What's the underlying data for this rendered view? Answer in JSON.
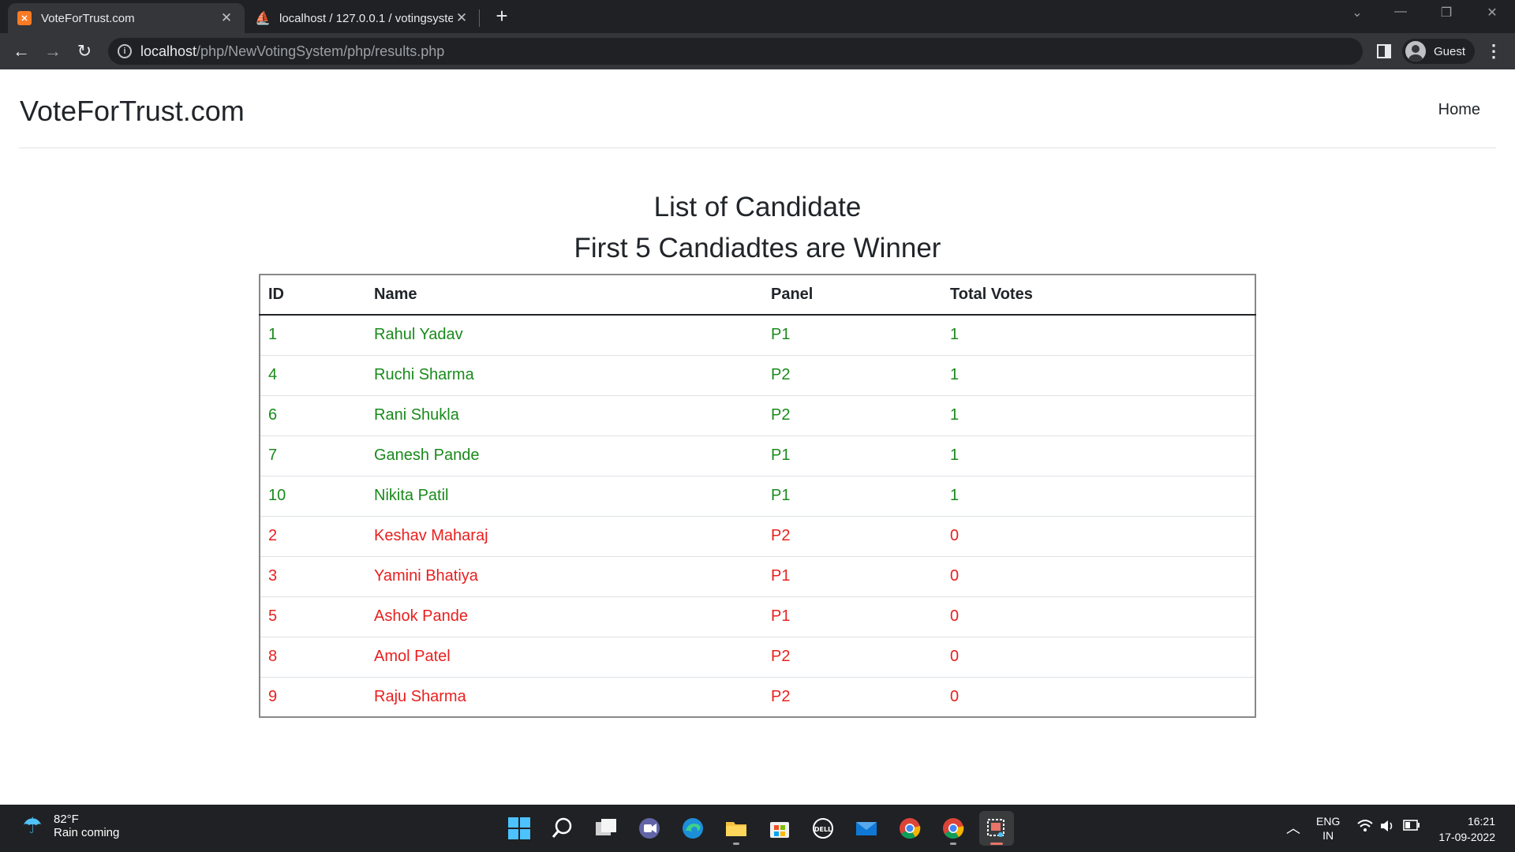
{
  "browser": {
    "tabs": [
      {
        "title": "VoteForTrust.com",
        "active": true,
        "favicon": "xampp-icon"
      },
      {
        "title": "localhost / 127.0.0.1 / votingsyste",
        "active": false,
        "favicon": "phpmyadmin-icon"
      }
    ],
    "url_host": "localhost",
    "url_path": "/php/NewVotingSystem/php/results.php",
    "profile_label": "Guest"
  },
  "site": {
    "brand": "VoteForTrust.com",
    "nav_home": "Home"
  },
  "main": {
    "title": "List of Candidate",
    "subtitle": "First 5 Candiadtes are Winner"
  },
  "table": {
    "headers": [
      "ID",
      "Name",
      "Panel",
      "Total Votes"
    ],
    "rows": [
      {
        "id": "1",
        "name": "Rahul Yadav",
        "panel": "P1",
        "votes": "1",
        "winner": true
      },
      {
        "id": "4",
        "name": "Ruchi Sharma",
        "panel": "P2",
        "votes": "1",
        "winner": true
      },
      {
        "id": "6",
        "name": "Rani Shukla",
        "panel": "P2",
        "votes": "1",
        "winner": true
      },
      {
        "id": "7",
        "name": "Ganesh Pande",
        "panel": "P1",
        "votes": "1",
        "winner": true
      },
      {
        "id": "10",
        "name": "Nikita Patil",
        "panel": "P1",
        "votes": "1",
        "winner": true
      },
      {
        "id": "2",
        "name": "Keshav Maharaj",
        "panel": "P2",
        "votes": "0",
        "winner": false
      },
      {
        "id": "3",
        "name": "Yamini Bhatiya",
        "panel": "P1",
        "votes": "0",
        "winner": false
      },
      {
        "id": "5",
        "name": "Ashok Pande",
        "panel": "P1",
        "votes": "0",
        "winner": false
      },
      {
        "id": "8",
        "name": "Amol Patel",
        "panel": "P2",
        "votes": "0",
        "winner": false
      },
      {
        "id": "9",
        "name": "Raju Sharma",
        "panel": "P2",
        "votes": "0",
        "winner": false
      }
    ]
  },
  "colors": {
    "winner": "#198a1b",
    "loser": "#e8201f"
  },
  "taskbar": {
    "weather_temp": "82°F",
    "weather_text": "Rain coming",
    "lang_top": "ENG",
    "lang_bottom": "IN",
    "time": "16:21",
    "date": "17-09-2022",
    "apps": [
      "windows-start-icon",
      "search-icon",
      "task-view-icon",
      "teams-chat-icon",
      "edge-icon",
      "file-explorer-icon",
      "store-icon",
      "dell-icon",
      "mail-icon",
      "chrome-icon",
      "chrome-icon",
      "snipping-tool-icon"
    ]
  }
}
